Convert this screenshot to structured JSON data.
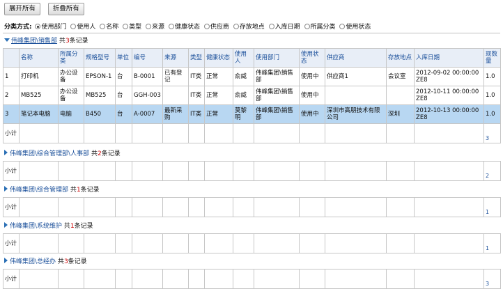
{
  "toolbar": {
    "expand_all": "展开所有",
    "collapse_all": "折叠所有"
  },
  "classify": {
    "label": "分类方式:",
    "options": [
      "使用部门",
      "使用人",
      "名称",
      "类型",
      "来源",
      "健康状态",
      "供应商",
      "存放地点",
      "入库日期",
      "所属分类",
      "使用状态"
    ],
    "selected": "使用部门"
  },
  "columns": [
    "",
    "名称",
    "所属分类",
    "规格型号",
    "单位",
    "编号",
    "来源",
    "类型",
    "健康状态",
    "使用人",
    "使用部门",
    "使用状态",
    "供应商",
    "存放地点",
    "入库日期",
    "现数量"
  ],
  "groups": [
    {
      "name": "伟峰集团\\销售部",
      "prefix": "共",
      "count": "3",
      "suffix": "条记录",
      "expanded": true,
      "rows": [
        [
          "1",
          "打印机",
          "办公设备",
          "EPSON-1",
          "台",
          "B-0001",
          "已有登记",
          "IT类",
          "正常",
          "俞威",
          "伟峰集团\\销售部",
          "使用中",
          "供应商1",
          "会议室",
          "2012-09-02 00:00:00ZE8",
          "1.0"
        ],
        [
          "2",
          "MB525",
          "办公设备",
          "MB525",
          "台",
          "GGH-003",
          "",
          "IT类",
          "正常",
          "俞威",
          "伟峰集团\\销售部",
          "使用中",
          "",
          "",
          "2012-10-11 00:00:00ZE8",
          "1.0"
        ],
        [
          "3",
          "笔记本电脑",
          "电脑",
          "B450",
          "台",
          "A-0007",
          "最新采购",
          "IT类",
          "正常",
          "莫黎明",
          "伟峰集团\\销售部",
          "使用中",
          "深圳市高朋技术有限公司",
          "深圳",
          "2012-10-13 00:00:00ZE8",
          "1.0"
        ]
      ],
      "subtotal_label": "小计",
      "subtotal_value": "3"
    },
    {
      "name": "伟峰集团\\综合管理部\\人事部",
      "prefix": "共",
      "count": "2",
      "suffix": "条记录",
      "expanded": false,
      "subtotal_label": "小计",
      "subtotal_value": "2"
    },
    {
      "name": "伟峰集团\\综合管理部",
      "prefix": "共",
      "count": "1",
      "suffix": "条记录",
      "expanded": false,
      "subtotal_label": "小计",
      "subtotal_value": "1"
    },
    {
      "name": "伟峰集团\\系统维护",
      "prefix": "共",
      "count": "1",
      "suffix": "条记录",
      "expanded": false,
      "subtotal_label": "小计",
      "subtotal_value": "1"
    },
    {
      "name": "伟峰集团\\总经办",
      "prefix": "共",
      "count": "3",
      "suffix": "条记录",
      "expanded": false,
      "subtotal_label": "小计",
      "subtotal_value": "3"
    }
  ],
  "selected_row": 2
}
